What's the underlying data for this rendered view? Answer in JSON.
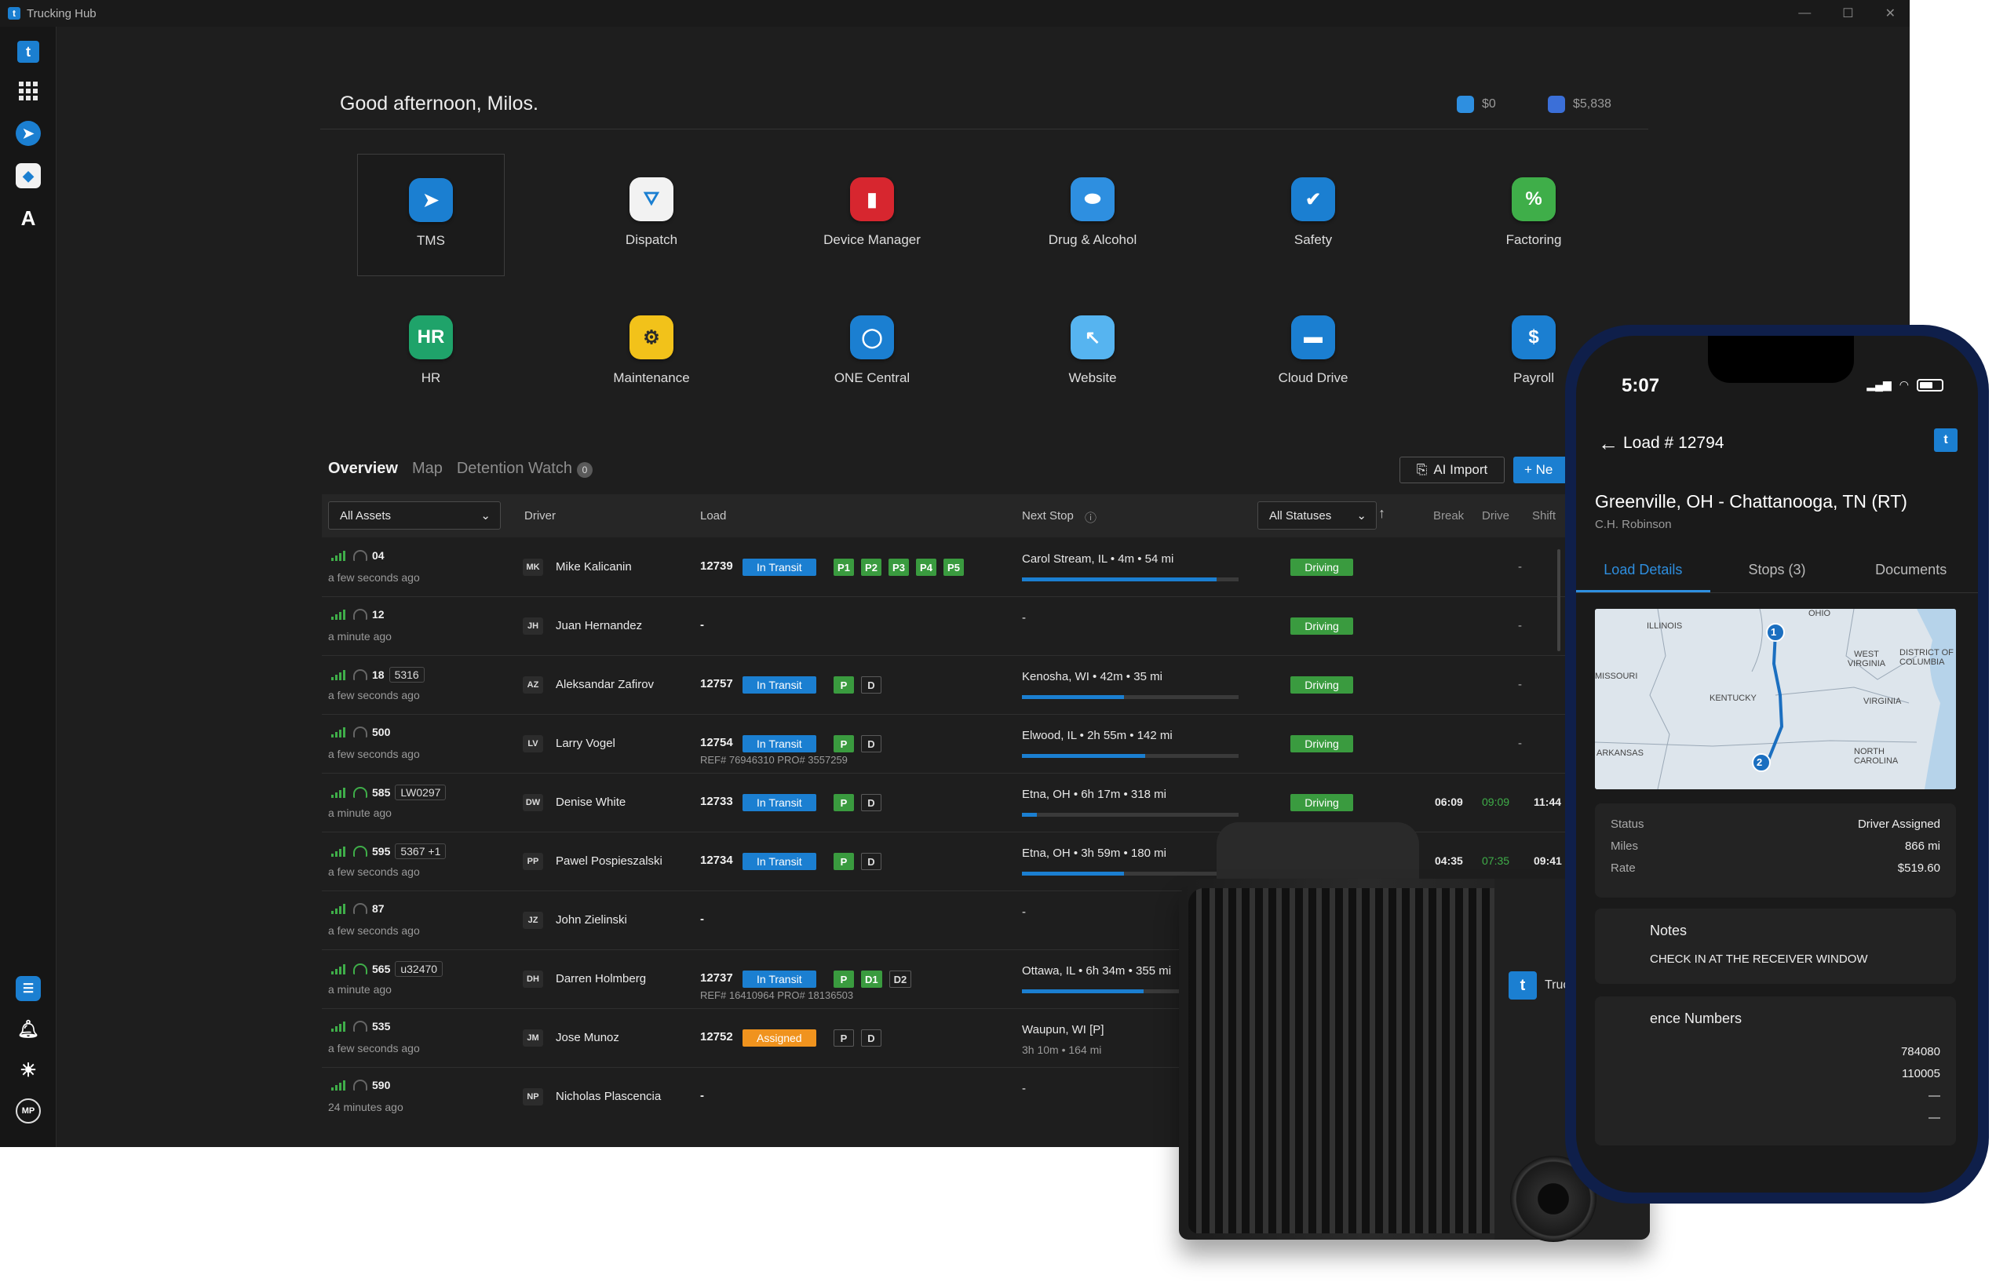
{
  "window": {
    "title": "Trucking Hub",
    "controls": [
      "—",
      "☐",
      "✕"
    ]
  },
  "sidebar": {
    "logo": "t",
    "bottom_avatar": "MP"
  },
  "greeting": "Good afternoon, Milos.",
  "balances": [
    {
      "value": "$0",
      "color": "#2e8fe0"
    },
    {
      "value": "$5,838",
      "color": "#3b6fd8"
    }
  ],
  "apps": [
    {
      "label": "TMS",
      "color": "#1b7fd1",
      "icon": "paper-plane-icon",
      "glyph": "➤"
    },
    {
      "label": "Dispatch",
      "color": "#f2f2f2",
      "icon": "map-pin-icon",
      "glyph": "⛛"
    },
    {
      "label": "Device Manager",
      "color": "#d7262f",
      "icon": "signal-bars-icon",
      "glyph": "▮"
    },
    {
      "label": "Drug & Alcohol",
      "color": "#2e8fe0",
      "icon": "pill-icon",
      "glyph": "⬬"
    },
    {
      "label": "Safety",
      "color": "#1b7fd1",
      "icon": "shield-icon",
      "glyph": "✔"
    },
    {
      "label": "Factoring",
      "color": "#3fae49",
      "icon": "percent-icon",
      "glyph": "%"
    },
    {
      "label": "HR",
      "color": "#1fa36a",
      "icon": "hr-icon",
      "glyph": "HR"
    },
    {
      "label": "Maintenance",
      "color": "#f2c21a",
      "icon": "wrench-icon",
      "glyph": "⚙"
    },
    {
      "label": "ONE Central",
      "color": "#1b7fd1",
      "icon": "one-central-icon",
      "glyph": "◯"
    },
    {
      "label": "Website",
      "color": "#56b4f0",
      "icon": "cursor-icon",
      "glyph": "↖"
    },
    {
      "label": "Cloud Drive",
      "color": "#1b7fd1",
      "icon": "folder-icon",
      "glyph": "▬"
    },
    {
      "label": "Payroll",
      "color": "#1b7fd1",
      "icon": "dollar-icon",
      "glyph": "$"
    }
  ],
  "tabs": [
    {
      "label": "Overview",
      "active": true
    },
    {
      "label": "Map"
    },
    {
      "label": "Detention Watch",
      "count": "0"
    }
  ],
  "actions": {
    "ai_import": "AI Import",
    "new": "+ Ne"
  },
  "table": {
    "asset_filter": "All Assets",
    "status_filter": "All Statuses",
    "headers": {
      "driver": "Driver",
      "load": "Load",
      "next_stop": "Next Stop",
      "break": "Break",
      "drive": "Drive",
      "shift": "Shift"
    },
    "rows": [
      {
        "unit": "04",
        "tag": "",
        "ago": "a few seconds ago",
        "wifi": false,
        "initials": "MK",
        "driver": "Mike Kalicanin",
        "load": "12739",
        "status": "In Transit",
        "stops": [
          "P1",
          "P2",
          "P3",
          "P4",
          "P5"
        ],
        "stops_done": 5,
        "ref": "",
        "next_stop": "Carol Stream, IL • 4m • 54 mi",
        "next_stop2": "",
        "progress": 0.9,
        "duty": "Driving",
        "break": "",
        "drive": "",
        "shift": "-"
      },
      {
        "unit": "12",
        "tag": "",
        "ago": "a minute ago",
        "wifi": false,
        "initials": "JH",
        "driver": "Juan Hernandez",
        "load": "-",
        "status": "",
        "stops": [],
        "stops_done": 0,
        "ref": "",
        "next_stop": "-",
        "next_stop2": "",
        "progress": null,
        "duty": "Driving",
        "break": "",
        "drive": "",
        "shift": "-"
      },
      {
        "unit": "18",
        "tag": "5316",
        "ago": "a few seconds ago",
        "wifi": false,
        "initials": "AZ",
        "driver": "Aleksandar Zafirov",
        "load": "12757",
        "status": "In Transit",
        "stops": [
          "P",
          "D"
        ],
        "stops_done": 1,
        "ref": "",
        "next_stop": "Kenosha, WI • 42m • 35 mi",
        "next_stop2": "",
        "progress": 0.47,
        "duty": "Driving",
        "break": "",
        "drive": "",
        "shift": "-"
      },
      {
        "unit": "500",
        "tag": "",
        "ago": "a few seconds ago",
        "wifi": false,
        "initials": "LV",
        "driver": "Larry Vogel",
        "load": "12754",
        "status": "In Transit",
        "stops": [
          "P",
          "D"
        ],
        "stops_done": 1,
        "ref": "REF# 76946310   PRO# 3557259",
        "next_stop": "Elwood, IL • 2h 55m • 142 mi",
        "next_stop2": "",
        "progress": 0.57,
        "duty": "Driving",
        "break": "",
        "drive": "",
        "shift": "-"
      },
      {
        "unit": "585",
        "tag": "LW0297",
        "ago": "a minute ago",
        "wifi": true,
        "initials": "DW",
        "driver": "Denise White",
        "load": "12733",
        "status": "In Transit",
        "stops": [
          "P",
          "D"
        ],
        "stops_done": 1,
        "ref": "",
        "next_stop": "Etna, OH • 6h 17m • 318 mi",
        "next_stop2": "",
        "progress": 0.07,
        "duty": "Driving",
        "break": "06:09",
        "drive": "09:09",
        "shift": "11:44"
      },
      {
        "unit": "595",
        "tag": "5367  +1",
        "ago": "a few seconds ago",
        "wifi": true,
        "initials": "PP",
        "driver": "Pawel Pospieszalski",
        "load": "12734",
        "status": "In Transit",
        "stops": [
          "P",
          "D"
        ],
        "stops_done": 1,
        "ref": "",
        "next_stop": "Etna, OH • 3h 59m • 180 mi",
        "next_stop2": "",
        "progress": 0.47,
        "duty": "",
        "break": "04:35",
        "drive": "07:35",
        "shift": "09:41"
      },
      {
        "unit": "87",
        "tag": "",
        "ago": "a few seconds ago",
        "wifi": false,
        "initials": "JZ",
        "driver": "John Zielinski",
        "load": "-",
        "status": "",
        "stops": [],
        "stops_done": 0,
        "ref": "",
        "next_stop": "-",
        "next_stop2": "",
        "progress": null,
        "duty": "",
        "break": "",
        "drive": "",
        "shift": ""
      },
      {
        "unit": "565",
        "tag": "u32470",
        "ago": "a minute ago",
        "wifi": true,
        "initials": "DH",
        "driver": "Darren Holmberg",
        "load": "12737",
        "status": "In Transit",
        "stops": [
          "P",
          "D1",
          "D2"
        ],
        "stops_done": 2,
        "ref": "REF# 16410964   PRO# 18136503",
        "next_stop": "Ottawa, IL • 6h 34m • 355 mi",
        "next_stop2": "",
        "progress": 0.56,
        "duty": "",
        "break": "",
        "drive": "",
        "shift": ""
      },
      {
        "unit": "535",
        "tag": "",
        "ago": "a few seconds ago",
        "wifi": false,
        "initials": "JM",
        "driver": "Jose Munoz",
        "load": "12752",
        "status": "Assigned",
        "stops": [
          "P",
          "D"
        ],
        "stops_done": 0,
        "ref": "",
        "next_stop": "Waupun, WI [P]",
        "next_stop2": "3h 10m • 164 mi",
        "progress": null,
        "duty": "",
        "break": "",
        "drive": "",
        "shift": ""
      },
      {
        "unit": "590",
        "tag": "",
        "ago": "24 minutes ago",
        "wifi": false,
        "initials": "NP",
        "driver": "Nicholas Plascencia",
        "load": "-",
        "status": "",
        "stops": [],
        "stops_done": 0,
        "ref": "",
        "next_stop": "-",
        "next_stop2": "",
        "progress": null,
        "duty": "",
        "break": "",
        "drive": "",
        "shift": ""
      }
    ]
  },
  "camera": {
    "brand": "Trucking Hub"
  },
  "phone": {
    "time": "5:07",
    "title": "Load # 12794",
    "route": "Greenville, OH - Chattanooga, TN (RT)",
    "customer": "C.H. Robinson",
    "tabs": [
      "Load Details",
      "Stops (3)",
      "Documents"
    ],
    "map_labels": [
      "ILLINOIS",
      "OHIO",
      "WEST VIRGINIA",
      "DISTRICT OF COLUMBIA",
      "MISSOURI",
      "KENTUCKY",
      "VIRGINIA",
      "ARKANSAS",
      "NORTH CAROLINA"
    ],
    "map_pins": [
      "1",
      "2"
    ],
    "details": [
      {
        "k": "Status",
        "v": "Driver Assigned"
      },
      {
        "k": "Miles",
        "v": "866 mi"
      },
      {
        "k": "Rate",
        "v": "$519.60"
      }
    ],
    "notes_title": "Notes",
    "notes_text": "CHECK IN AT THE RECEIVER WINDOW",
    "refs_title": "ence Numbers",
    "refs": [
      "784080",
      "110005",
      "—",
      "—"
    ]
  }
}
